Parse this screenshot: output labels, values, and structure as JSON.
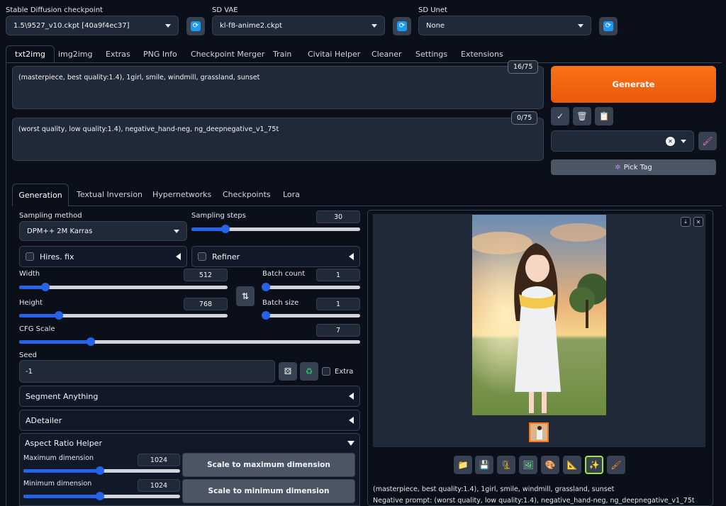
{
  "top": {
    "checkpoint": {
      "label": "Stable Diffusion checkpoint",
      "value": "1.5\\9527_v10.ckpt [40a9f4ec37]"
    },
    "vae": {
      "label": "SD VAE",
      "value": "kl-f8-anime2.ckpt"
    },
    "unet": {
      "label": "SD Unet",
      "value": "None"
    }
  },
  "tabs": [
    "txt2img",
    "img2img",
    "Extras",
    "PNG Info",
    "Checkpoint Merger",
    "Train",
    "Civitai Helper",
    "Cleaner",
    "Settings",
    "Extensions"
  ],
  "prompt": {
    "text": "(masterpiece, best quality:1.4), 1girl, smile, windmill, grassland, sunset",
    "counter": "16/75"
  },
  "negative": {
    "text": "(worst quality, low quality:1.4), negative_hand-neg, ng_deepnegative_v1_75t",
    "counter": "0/75"
  },
  "actions": {
    "generate": "Generate",
    "pick_tag": "Pick Tag",
    "tool_icons": [
      "check-icon",
      "trash-icon",
      "clipboard-icon"
    ],
    "clear_glyph": "✕"
  },
  "subtabs": [
    "Generation",
    "Textual Inversion",
    "Hypernetworks",
    "Checkpoints",
    "Lora"
  ],
  "generation": {
    "sampling_method_label": "Sampling method",
    "sampling_method": "DPM++ 2M Karras",
    "sampling_steps_label": "Sampling steps",
    "sampling_steps": "30",
    "sampling_steps_fraction": 0.2,
    "hires_fix": "Hires. fix",
    "refiner": "Refiner",
    "width_label": "Width",
    "width": "512",
    "width_fraction": 0.125,
    "height_label": "Height",
    "height": "768",
    "height_fraction": 0.19,
    "batch_count_label": "Batch count",
    "batch_count": "1",
    "batch_size_label": "Batch size",
    "batch_size": "1",
    "cfg_label": "CFG Scale",
    "cfg": "7",
    "cfg_fraction": 0.21,
    "seed_label": "Seed",
    "seed": "-1",
    "extra": "Extra",
    "segment_anything": "Segment Anything",
    "adetailer": "ADetailer",
    "aspect_ratio_helper": "Aspect Ratio Helper",
    "max_dim_label": "Maximum dimension",
    "max_dim": "1024",
    "min_dim_label": "Minimum dimension",
    "min_dim": "1024",
    "scale_max": "Scale to maximum dimension",
    "scale_min": "Scale to minimum dimension"
  },
  "output": {
    "info_prompt": "(masterpiece, best quality:1.4), 1girl, smile, windmill, grassland, sunset",
    "info_negative": "Negative prompt: (worst quality, low quality:1.4), negative_hand-neg, ng_deepnegative_v1_75t",
    "toolbar_icons": [
      "folder-icon",
      "save-icon",
      "zip-icon",
      "image-icon",
      "palette-icon",
      "ruler-icon",
      "sparkle-icon",
      "brush-icon"
    ]
  },
  "colors": {
    "accent": "#f97316",
    "slider": "#2563eb",
    "bg": "#0b0f19",
    "highlight": "#a3e635"
  }
}
